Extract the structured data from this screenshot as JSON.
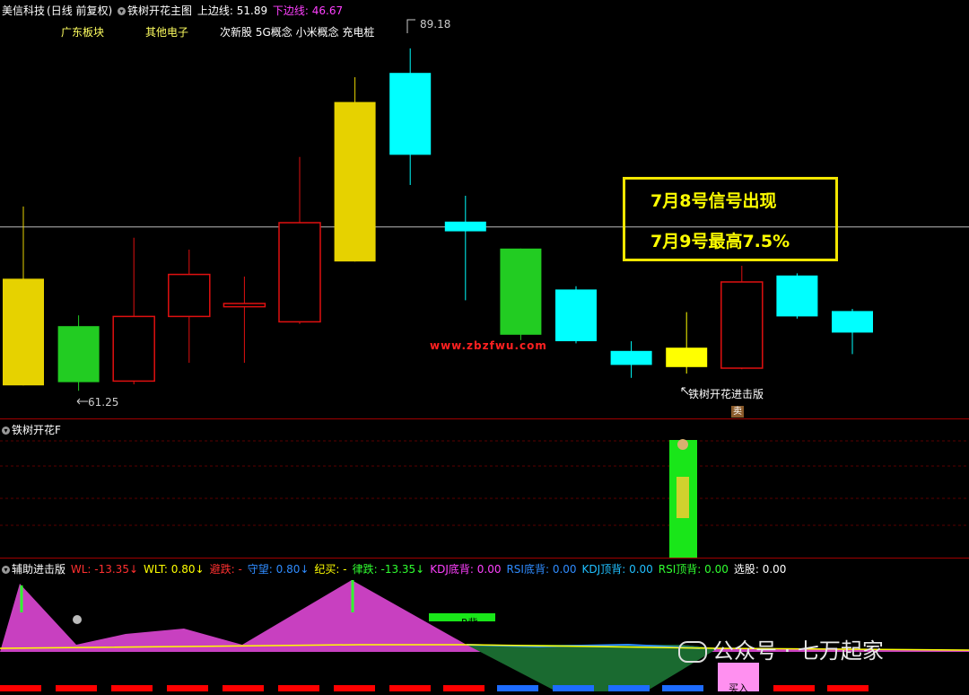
{
  "header": {
    "stock_name": "美信科技",
    "period": "(日线 前复权)",
    "indicator": "铁树开花主图",
    "upper_label": "上边线: ",
    "upper_value": "51.89",
    "lower_label": "下边线: ",
    "lower_value": "46.67"
  },
  "tags": [
    "广东板块",
    "其他电子",
    "次新股 5G概念 小米概念 充电桩"
  ],
  "callout": {
    "line1": "7月8号信号出现",
    "line2": "7月9号最高7.5%"
  },
  "watermark": "www.zbzfwu.com",
  "notes": {
    "high": "89.18",
    "low": "61.25",
    "signal": "铁树开花进击版",
    "sell_glyph": "卖",
    "bar_text": "R背",
    "buy_text": "买入"
  },
  "mid_header": "铁树开花F",
  "low_header": {
    "title": "辅助进击版",
    "items": [
      {
        "label": "WL: ",
        "value": "-13.35",
        "arrow": "↓",
        "color": "#ff3030"
      },
      {
        "label": "WLT: ",
        "value": "0.80",
        "arrow": "↓",
        "color": "#ffff00"
      },
      {
        "label": "避跌: ",
        "value": "-",
        "arrow": "",
        "color": "#ff3030"
      },
      {
        "label": "守望: ",
        "value": "0.80",
        "arrow": "↓",
        "color": "#2f8cff"
      },
      {
        "label": "纪买: ",
        "value": "-",
        "arrow": "",
        "color": "#ffff00"
      },
      {
        "label": "律跌: ",
        "value": "-13.35",
        "arrow": "↓",
        "color": "#30ff30"
      },
      {
        "label": "KDJ底背: ",
        "value": "0.00",
        "arrow": "",
        "color": "#ff40ff"
      },
      {
        "label": "RSI底背: ",
        "value": "0.00",
        "arrow": "",
        "color": "#2f8cff"
      },
      {
        "label": "KDJ顶背: ",
        "value": "0.00",
        "arrow": "",
        "color": "#20c0ff"
      },
      {
        "label": "RSI顶背: ",
        "value": "0.00",
        "arrow": "",
        "color": "#30ff30"
      },
      {
        "label": "选股: ",
        "value": "0.00",
        "arrow": "",
        "color": "#ffffff"
      }
    ]
  },
  "wechat": "公众号 · 七万起家",
  "chart_data": {
    "type": "candlestick",
    "price_range": [
      57,
      92
    ],
    "hline": 72.6,
    "candles": [
      {
        "o": 67.8,
        "c": 57.9,
        "h": 74.5,
        "l": 57.9,
        "color": "#e6d200",
        "style": "filled"
      },
      {
        "o": 63.4,
        "c": 58.2,
        "h": 64.4,
        "l": 57.4,
        "color": "#22cc22",
        "style": "filled"
      },
      {
        "o": 58.3,
        "c": 64.3,
        "h": 71.6,
        "l": 58.0,
        "color": "#e01010",
        "style": "hollow"
      },
      {
        "o": 64.3,
        "c": 68.2,
        "h": 70.5,
        "l": 60.0,
        "color": "#e01010",
        "style": "hollow"
      },
      {
        "o": 65.2,
        "c": 65.5,
        "h": 68.0,
        "l": 60.0,
        "color": "#e01010",
        "style": "hollow"
      },
      {
        "o": 63.8,
        "c": 73.0,
        "h": 79.1,
        "l": 63.6,
        "color": "#e01010",
        "style": "hollow"
      },
      {
        "o": 84.2,
        "c": 69.4,
        "h": 86.5,
        "l": 69.4,
        "color": "#e6d200",
        "style": "filled"
      },
      {
        "o": 86.9,
        "c": 79.3,
        "h": 89.18,
        "l": 76.5,
        "color": "#00ffff",
        "style": "filled"
      },
      {
        "o": 73.1,
        "c": 72.2,
        "h": 75.5,
        "l": 65.8,
        "color": "#00ffff",
        "style": "filled"
      },
      {
        "o": 70.6,
        "c": 62.6,
        "h": 70.6,
        "l": 62.1,
        "color": "#22cc22",
        "style": "filled"
      },
      {
        "o": 66.8,
        "c": 62.0,
        "h": 67.1,
        "l": 61.8,
        "color": "#00ffff",
        "style": "filled"
      },
      {
        "o": 61.1,
        "c": 59.8,
        "h": 62.0,
        "l": 58.6,
        "color": "#00ffff",
        "style": "filled"
      },
      {
        "o": 61.4,
        "c": 59.6,
        "h": 64.7,
        "l": 59.0,
        "color": "#ffff00",
        "style": "filled"
      },
      {
        "o": 59.5,
        "c": 67.5,
        "h": 69.0,
        "l": 59.4,
        "color": "#e01010",
        "style": "hollow"
      },
      {
        "o": 68.1,
        "c": 64.3,
        "h": 68.3,
        "l": 64.1,
        "color": "#00ffff",
        "style": "filled"
      },
      {
        "o": 64.8,
        "c": 62.8,
        "h": 65.0,
        "l": 60.8,
        "color": "#00ffff",
        "style": "filled"
      }
    ]
  }
}
